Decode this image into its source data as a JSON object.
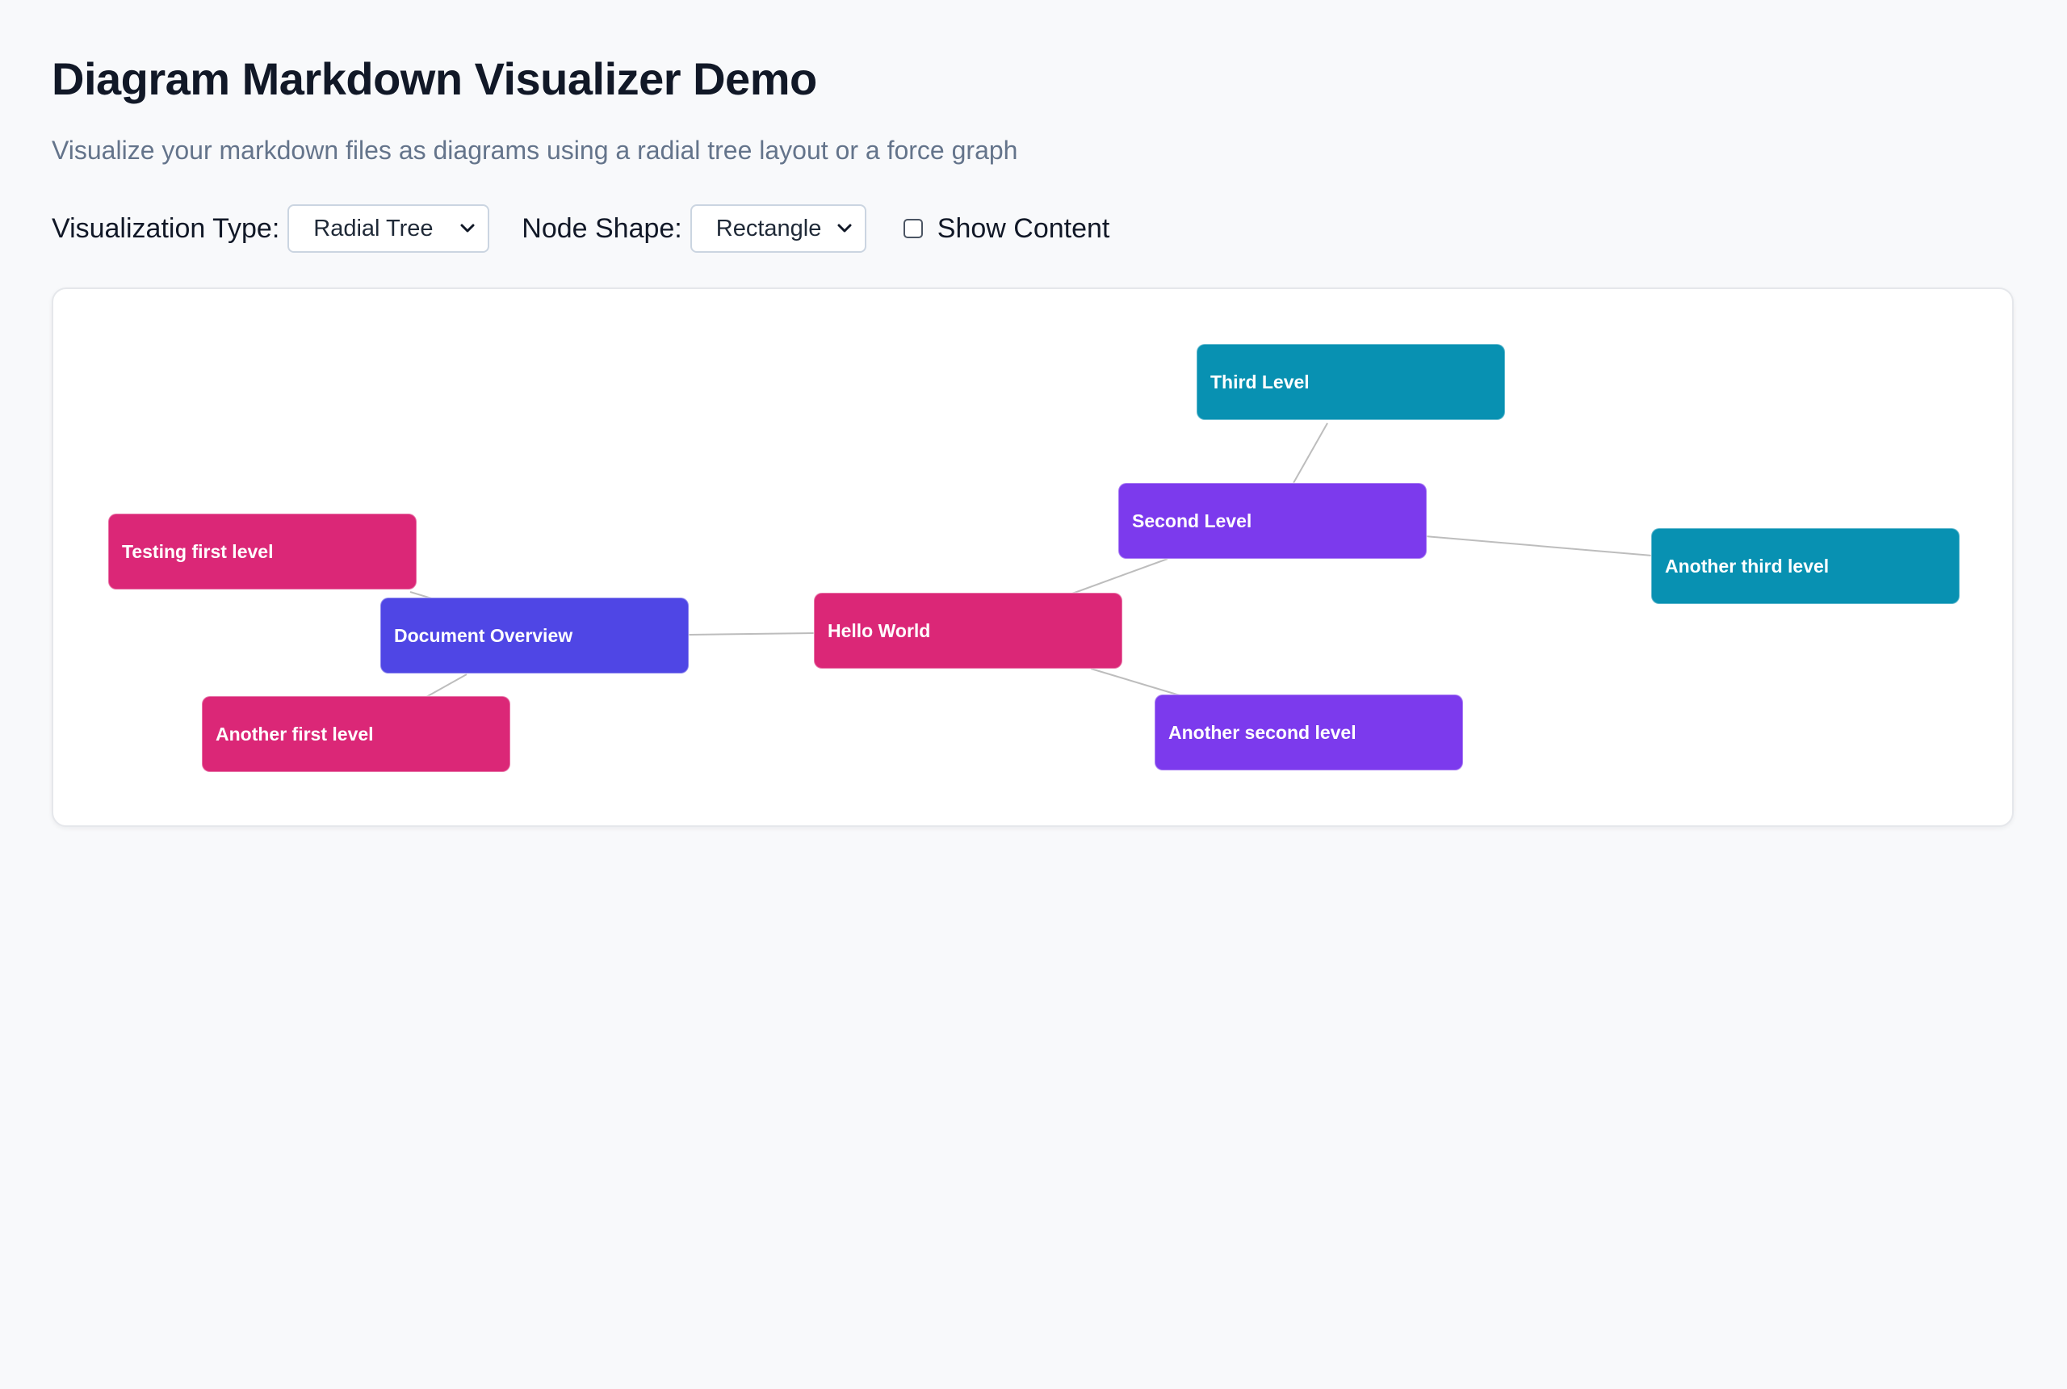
{
  "page": {
    "title": "Diagram Markdown Visualizer Demo",
    "subtitle": "Visualize your markdown files as diagrams using a radial tree layout or a force graph"
  },
  "controls": {
    "visualization_type": {
      "label": "Visualization Type:",
      "value": "Radial Tree"
    },
    "node_shape": {
      "label": "Node Shape:",
      "value": "Rectangle"
    },
    "show_content": {
      "label": "Show Content",
      "checked": false
    }
  },
  "diagram": {
    "nodes": {
      "hello_world": {
        "label": "Hello World",
        "level": 0
      },
      "document_overview": {
        "label": "Document Overview",
        "level": 1
      },
      "testing_first_level": {
        "label": "Testing first level",
        "level": 1
      },
      "another_first_level": {
        "label": "Another first level",
        "level": 1
      },
      "second_level": {
        "label": "Second Level",
        "level": 2
      },
      "another_second_level": {
        "label": "Another second level",
        "level": 2
      },
      "third_level": {
        "label": "Third Level",
        "level": 3
      },
      "another_third_level": {
        "label": "Another third level",
        "level": 3
      }
    },
    "edges": [
      [
        "hello_world",
        "document_overview"
      ],
      [
        "document_overview",
        "testing_first_level"
      ],
      [
        "document_overview",
        "another_first_level"
      ],
      [
        "hello_world",
        "second_level"
      ],
      [
        "hello_world",
        "another_second_level"
      ],
      [
        "second_level",
        "third_level"
      ],
      [
        "second_level",
        "another_third_level"
      ]
    ],
    "colors": {
      "pink": "#db2777",
      "indigo": "#4f46e5",
      "purple": "#7c3aed",
      "cyan": "#0891b2",
      "edge": "#bdbdbd"
    }
  }
}
